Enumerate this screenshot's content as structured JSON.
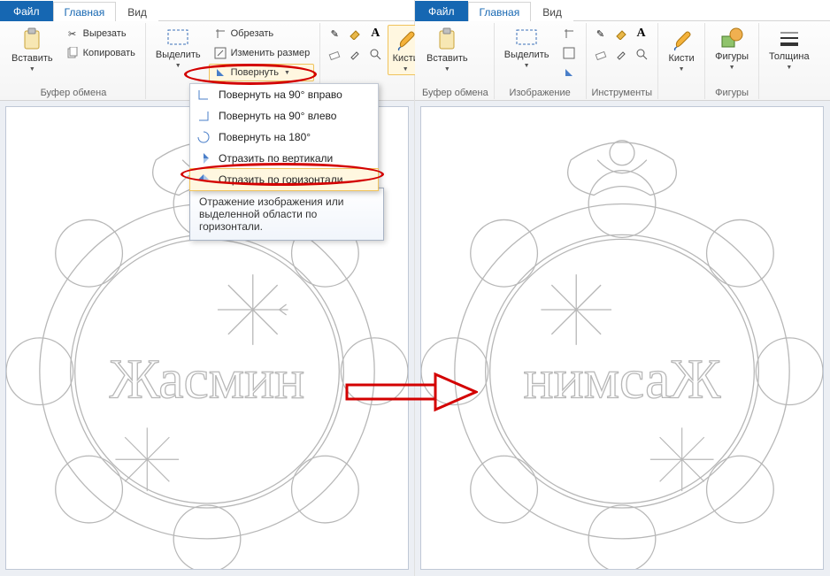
{
  "tabs": {
    "file": "Файл",
    "home": "Главная",
    "view": "Вид"
  },
  "ribbon": {
    "clipboard": {
      "label": "Буфер обмена",
      "paste": "Вставить",
      "cut": "Вырезать",
      "copy": "Копировать"
    },
    "image": {
      "label": "Изображение",
      "select": "Выделить",
      "crop": "Обрезать",
      "resize": "Изменить размер",
      "rotate": "Повернуть"
    },
    "tools": {
      "label": "Инструменты"
    },
    "brushes": {
      "label": "Кисти"
    },
    "shapes": {
      "label": "Фигуры",
      "btn": "Фигуры"
    },
    "thickness": {
      "label": "Толщина"
    }
  },
  "rotate_menu": {
    "items": [
      "Повернуть на 90° вправо",
      "Повернуть на 90° влево",
      "Повернуть на 180°",
      "Отразить по вертикали",
      "Отразить по горизонтали"
    ]
  },
  "tooltip": {
    "text": "Отражение изображения или выделенной области по горизонтали."
  },
  "canvas": {
    "text_left": "Жасмин",
    "text_right": "нимсаЖ"
  }
}
